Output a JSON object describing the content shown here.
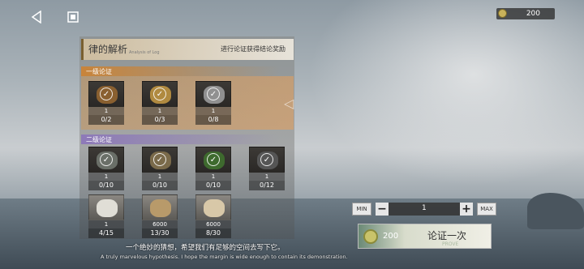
{
  "currency": {
    "value": "200",
    "icon": "coin-icon"
  },
  "title": {
    "main": "律的解析",
    "sub": "Analysis of Log",
    "hint": "进行论证获得结论奖励"
  },
  "level1": {
    "label": "一级论证",
    "items": [
      {
        "qty": "1",
        "progress": "0/2",
        "tone": "#8a6030"
      },
      {
        "qty": "1",
        "progress": "0/3",
        "tone": "#b08a40"
      },
      {
        "qty": "1",
        "progress": "0/8",
        "tone": "#909090"
      }
    ]
  },
  "level2": {
    "label": "二级论证",
    "items": [
      {
        "qty": "1",
        "progress": "0/10",
        "tone": "#6a6f68"
      },
      {
        "qty": "1",
        "progress": "0/10",
        "tone": "#7a6a4a"
      },
      {
        "qty": "1",
        "progress": "0/10",
        "tone": "#3e6a2e"
      },
      {
        "qty": "1",
        "progress": "0/12",
        "tone": "#555"
      },
      {
        "qty": "1",
        "progress": "4/15",
        "tone": "#e0ded6"
      },
      {
        "qty": "6000",
        "progress": "13/30",
        "tone": "#b89a6a"
      },
      {
        "qty": "6000",
        "progress": "8/30",
        "tone": "#d8c8a8"
      }
    ]
  },
  "quote": {
    "zh": "一个绝妙的猜想，希望我们有足够的空间去写下它。",
    "en": "A truly marvelous hypothesis. I hope the margin is wide enough to contain its demonstration."
  },
  "stepper": {
    "min_label": "MIN",
    "max_label": "MAX",
    "value": "1"
  },
  "prove": {
    "cost": "200",
    "label": "论证一次",
    "sub": "PROVE"
  }
}
